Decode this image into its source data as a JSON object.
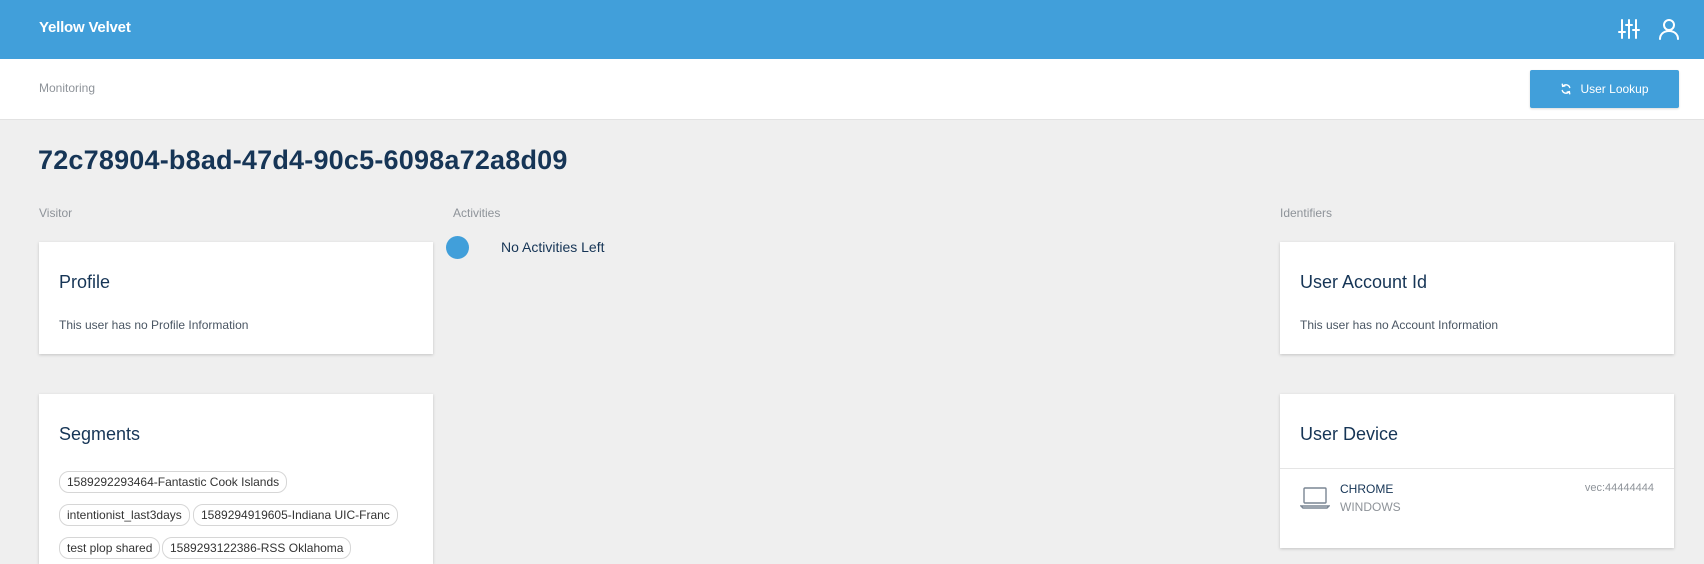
{
  "header": {
    "brand": "Yellow Velvet",
    "icons": [
      "sliders-icon",
      "user-icon"
    ]
  },
  "subheader": {
    "breadcrumb": "Monitoring",
    "lookup_button": "User Lookup"
  },
  "page": {
    "title": "72c78904-b8ad-47d4-90c5-6098a72a8d09"
  },
  "columns": {
    "visitor": "Visitor",
    "activities": "Activities",
    "identifiers": "Identifiers"
  },
  "profile": {
    "title": "Profile",
    "text": "This user has no Profile Information"
  },
  "segments": {
    "title": "Segments",
    "chips": [
      "1589292293464-Fantastic Cook Islands",
      "intentionist_last3days",
      "1589294919605-Indiana UIC-Franc",
      "test plop shared",
      "1589293122386-RSS Oklahoma"
    ]
  },
  "activities": {
    "status": "No Activities Left"
  },
  "account": {
    "title": "User Account Id",
    "text": "This user has no Account Information"
  },
  "device": {
    "title": "User Device",
    "browser": "CHROME",
    "os": "WINDOWS",
    "vec": "vec:44444444"
  },
  "colors": {
    "accent": "#419fda",
    "background": "#efefef",
    "title": "#163556"
  }
}
